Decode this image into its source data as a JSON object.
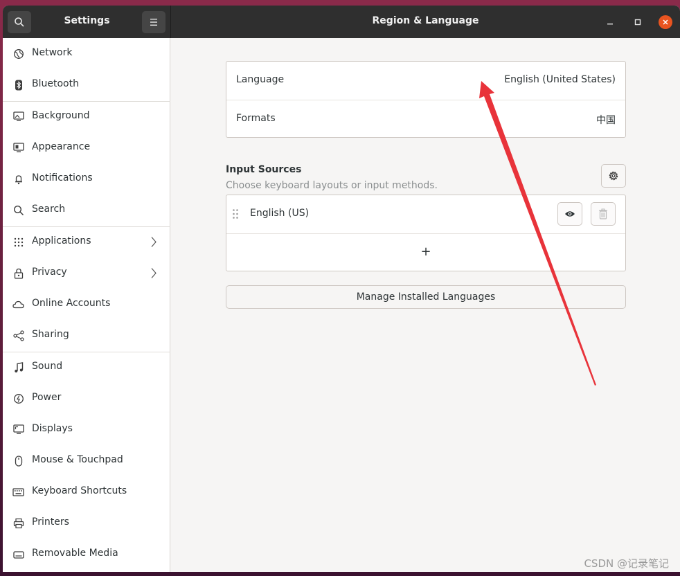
{
  "titlebar": {
    "left_title": "Settings",
    "main_title": "Region & Language",
    "search_icon": "search-icon",
    "menu_icon": "hamburger-menu-icon"
  },
  "sidebar": {
    "items": [
      {
        "label": "Network",
        "icon": "network-icon"
      },
      {
        "label": "Bluetooth",
        "icon": "bluetooth-icon"
      },
      {
        "label": "Background",
        "icon": "background-icon"
      },
      {
        "label": "Appearance",
        "icon": "appearance-icon"
      },
      {
        "label": "Notifications",
        "icon": "bell-icon"
      },
      {
        "label": "Search",
        "icon": "search-icon"
      },
      {
        "label": "Applications",
        "icon": "apps-grid-icon"
      },
      {
        "label": "Privacy",
        "icon": "lock-icon"
      },
      {
        "label": "Online Accounts",
        "icon": "cloud-icon"
      },
      {
        "label": "Sharing",
        "icon": "share-icon"
      },
      {
        "label": "Sound",
        "icon": "music-note-icon"
      },
      {
        "label": "Power",
        "icon": "power-icon"
      },
      {
        "label": "Displays",
        "icon": "display-icon"
      },
      {
        "label": "Mouse & Touchpad",
        "icon": "mouse-icon"
      },
      {
        "label": "Keyboard Shortcuts",
        "icon": "keyboard-icon"
      },
      {
        "label": "Printers",
        "icon": "printer-icon"
      },
      {
        "label": "Removable Media",
        "icon": "removable-media-icon"
      }
    ]
  },
  "main": {
    "language_label": "Language",
    "language_value": "English (United States)",
    "formats_label": "Formats",
    "formats_value": "中国",
    "input_sources_title": "Input Sources",
    "input_sources_subtitle": "Choose keyboard layouts or input methods.",
    "input_source_item": "English (US)",
    "add_symbol": "+",
    "manage_button": "Manage Installed Languages"
  },
  "watermark": "CSDN @记录笔记",
  "colors": {
    "accent": "#e95420",
    "annotation_arrow": "#e8333a",
    "titlebar": "#2f2f2f"
  }
}
